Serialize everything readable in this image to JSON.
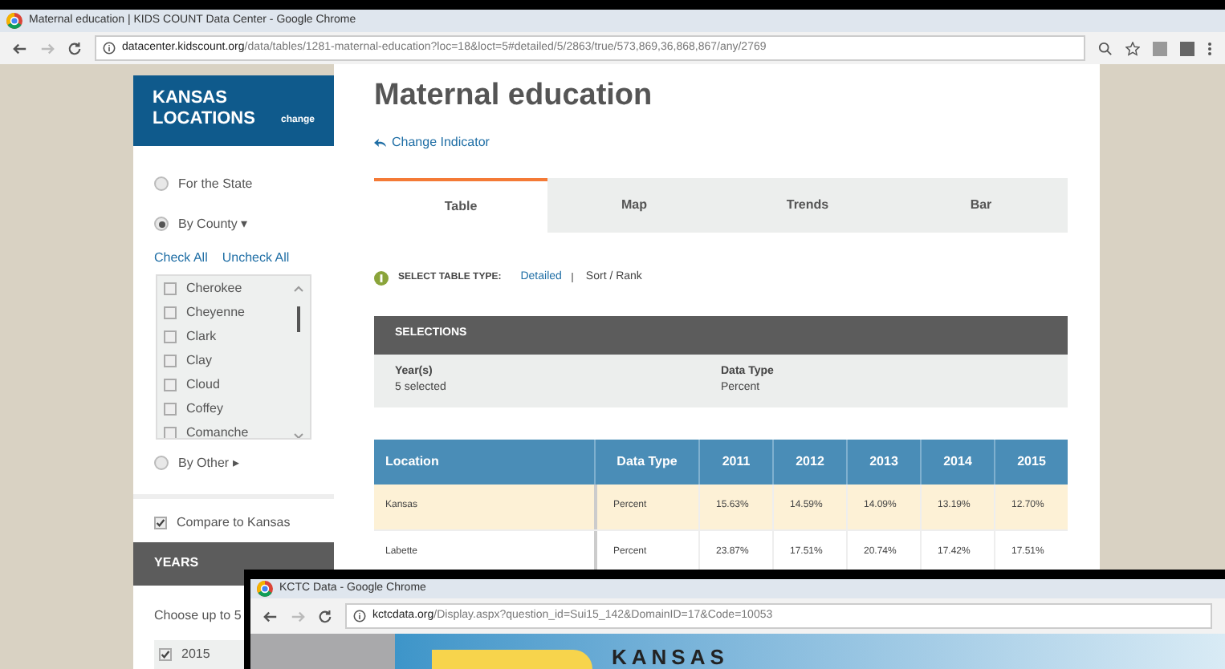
{
  "browser": {
    "title": "Maternal education | KIDS COUNT Data Center - Google Chrome",
    "url_host": "datacenter.kidscount.org",
    "url_path": "/data/tables/1281-maternal-education?loc=18&loct=5#detailed/5/2863/true/573,869,36,868,867/any/2769"
  },
  "sidebar": {
    "heading": "KANSAS LOCATIONS",
    "change": "change",
    "options": [
      {
        "label": "For the State",
        "selected": false
      },
      {
        "label": "By County",
        "selected": true,
        "arrow": "▾"
      }
    ],
    "check_all": "Check All",
    "uncheck_all": "Uncheck All",
    "counties": [
      {
        "label": "Cherokee",
        "checked": false
      },
      {
        "label": "Cheyenne",
        "checked": false
      },
      {
        "label": "Clark",
        "checked": false
      },
      {
        "label": "Clay",
        "checked": false
      },
      {
        "label": "Cloud",
        "checked": false
      },
      {
        "label": "Coffey",
        "checked": false
      },
      {
        "label": "Comanche",
        "checked": false
      }
    ],
    "by_other": {
      "label": "By Other",
      "selected": false,
      "arrow": "▸"
    },
    "compare": {
      "label": "Compare to Kansas",
      "checked": true
    },
    "years_heading": "YEARS",
    "years_hint": "Choose up to 5",
    "years": [
      {
        "label": "2015",
        "checked": true
      }
    ]
  },
  "main": {
    "title": "Maternal education",
    "change_indicator": "Change Indicator",
    "tabs": [
      {
        "label": "Table",
        "selected": true
      },
      {
        "label": "Map",
        "selected": false
      },
      {
        "label": "Trends",
        "selected": false
      },
      {
        "label": "Bar",
        "selected": false
      }
    ],
    "table_type_label": "SELECT TABLE TYPE:",
    "table_types": [
      {
        "label": "Detailed",
        "selected": true
      },
      {
        "label": "Sort / Rank",
        "selected": false
      }
    ],
    "selections": {
      "heading": "SELECTIONS",
      "items": [
        {
          "label": "Year(s)",
          "value": "5 selected"
        },
        {
          "label": "Data Type",
          "value": "Percent"
        }
      ]
    },
    "table": {
      "columns": [
        "Location",
        "Data Type",
        "2011",
        "2012",
        "2013",
        "2014",
        "2015"
      ],
      "rows": [
        {
          "highlighted": true,
          "cells": [
            "Kansas",
            "Percent",
            "15.63%",
            "14.59%",
            "14.09%",
            "13.19%",
            "12.70%"
          ]
        },
        {
          "highlighted": false,
          "cells": [
            "Labette",
            "Percent",
            "23.87%",
            "17.51%",
            "20.74%",
            "17.42%",
            "17.51%"
          ]
        }
      ]
    }
  },
  "second_window": {
    "title": "KCTC Data - Google Chrome",
    "url_host": "kctcdata.org",
    "url_path": "/Display.aspx?question_id=Sui15_142&DomainID=17&Code=10053",
    "banner": "KANSAS"
  }
}
